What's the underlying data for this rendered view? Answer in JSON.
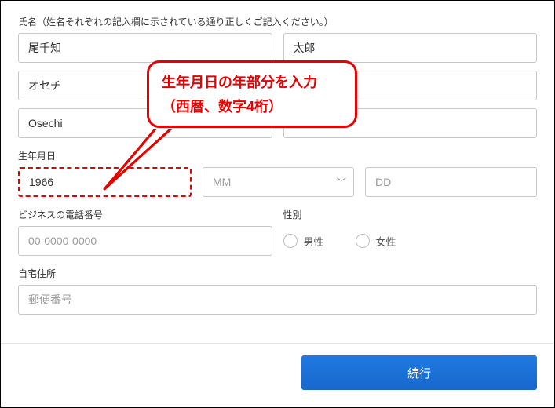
{
  "labels": {
    "name": "氏名（姓名それぞれの記入欄に示されている通り正しくご記入ください。）",
    "dob": "生年月日",
    "phone": "ビジネスの電話番号",
    "gender": "性別",
    "address": "自宅住所"
  },
  "fields": {
    "last_name": "尾千知",
    "first_name": "太郎",
    "last_kana": "オセチ",
    "first_kana": "",
    "last_roman": "Osechi",
    "first_roman": "",
    "dob_year": "1966",
    "dob_month_placeholder": "MM",
    "dob_day_placeholder": "DD",
    "phone_placeholder": "00-0000-0000",
    "postal_placeholder": "郵便番号"
  },
  "gender": {
    "male": "男性",
    "female": "女性"
  },
  "callout": {
    "line1": "生年月日の年部分を入力",
    "line2": "（西暦、数字4桁）"
  },
  "submit": "続行"
}
